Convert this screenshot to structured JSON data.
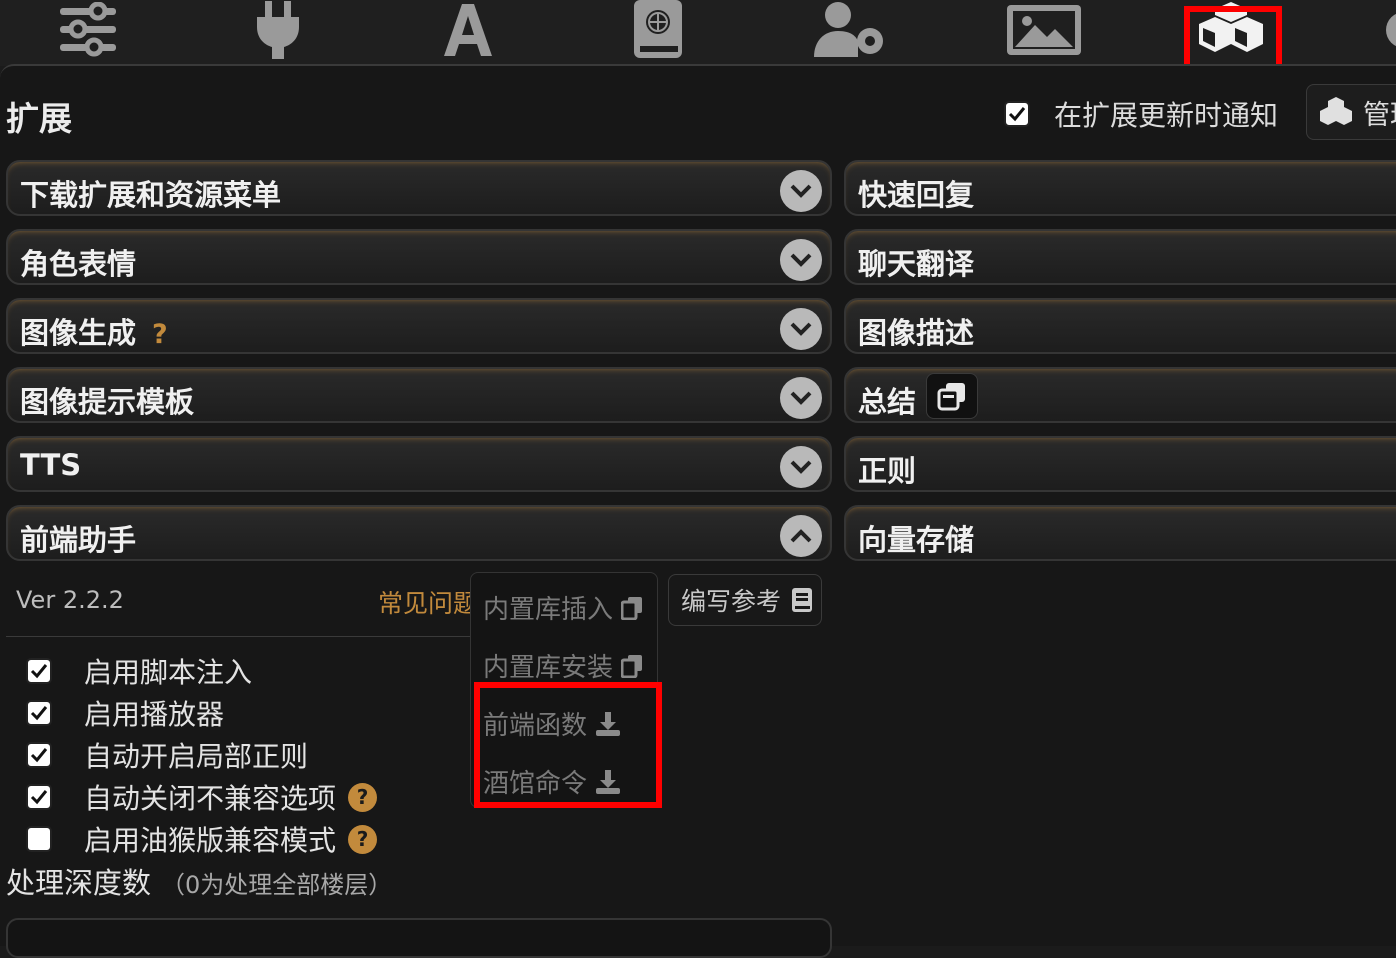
{
  "toolbar": {
    "icons": [
      "sliders-icon",
      "plug-icon",
      "font-icon",
      "book-globe-icon",
      "user-gear-icon",
      "image-icon",
      "cubes-icon"
    ],
    "active": "cubes-icon"
  },
  "header": {
    "title": "扩展",
    "notify_label": "在扩展更新时通知",
    "notify_checked": true,
    "manage_label": "管理"
  },
  "left_drawers": [
    {
      "label": "下载扩展和资源菜单",
      "expanded": false
    },
    {
      "label": "角色表情",
      "expanded": false
    },
    {
      "label": "图像生成",
      "expanded": false,
      "help": "?"
    },
    {
      "label": "图像提示模板",
      "expanded": false
    },
    {
      "label": "TTS",
      "expanded": false
    },
    {
      "label": "前端助手",
      "expanded": true
    }
  ],
  "right_drawers": [
    {
      "label": "快速回复"
    },
    {
      "label": "聊天翻译"
    },
    {
      "label": "图像描述"
    },
    {
      "label": "总结"
    },
    {
      "label": "正则"
    },
    {
      "label": "向量存储"
    }
  ],
  "helper": {
    "version": "Ver 2.2.2",
    "faq": "常见问题",
    "dropdown": [
      {
        "label": "内置库插入",
        "icon": "copy-icon"
      },
      {
        "label": "内置库安装",
        "icon": "copy-icon"
      },
      {
        "label": "前端函数",
        "icon": "download-icon"
      },
      {
        "label": "酒馆命令",
        "icon": "download-icon"
      }
    ],
    "reference_label": "编写参考",
    "options": [
      {
        "label": "启用脚本注入",
        "checked": true,
        "help": false
      },
      {
        "label": "启用播放器",
        "checked": true,
        "help": false
      },
      {
        "label": "自动开启局部正则",
        "checked": true,
        "help": false
      },
      {
        "label": "自动关闭不兼容选项",
        "checked": true,
        "help": true
      },
      {
        "label": "启用油猴版兼容模式",
        "checked": false,
        "help": true
      }
    ],
    "depth_label": "处理深度数",
    "depth_hint": "（0为处理全部楼层）"
  },
  "colors": {
    "accent": "#c28a3c",
    "highlight": "#ff0000"
  }
}
